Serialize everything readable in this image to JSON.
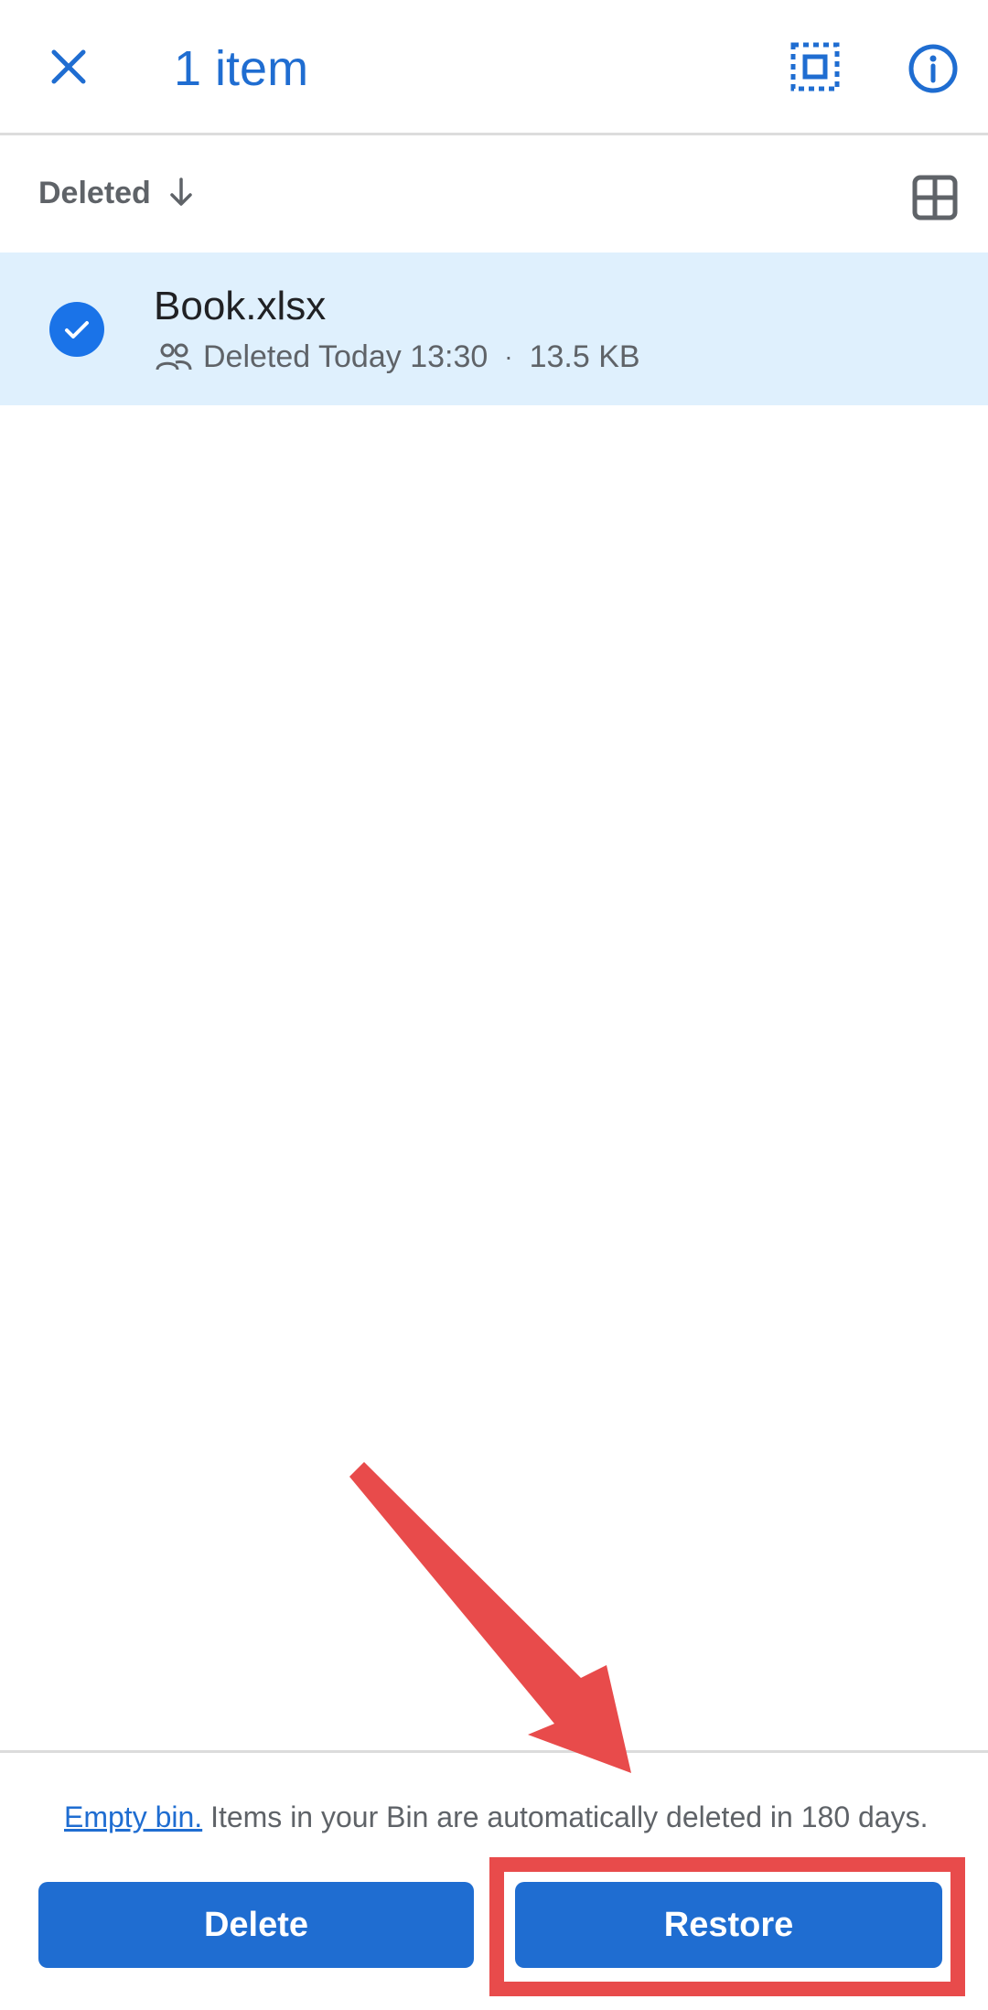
{
  "header": {
    "title": "1 item"
  },
  "sort": {
    "label": "Deleted"
  },
  "file": {
    "name": "Book.xlsx",
    "deleted_text": "Deleted Today 13:30",
    "separator": "·",
    "size": "13.5 KB"
  },
  "footer": {
    "empty_bin_link": "Empty bin.",
    "notice": " Items in your Bin are automatically deleted in 180 days.",
    "delete_label": "Delete",
    "restore_label": "Restore"
  },
  "colors": {
    "accent": "#1f6dd1",
    "selected_row": "#dff0fd",
    "annotation": "#e84b4b"
  },
  "icons": [
    "close-icon",
    "select-all-icon",
    "info-icon",
    "sort-down-arrow-icon",
    "grid-view-icon",
    "check-icon",
    "shared-people-icon"
  ]
}
